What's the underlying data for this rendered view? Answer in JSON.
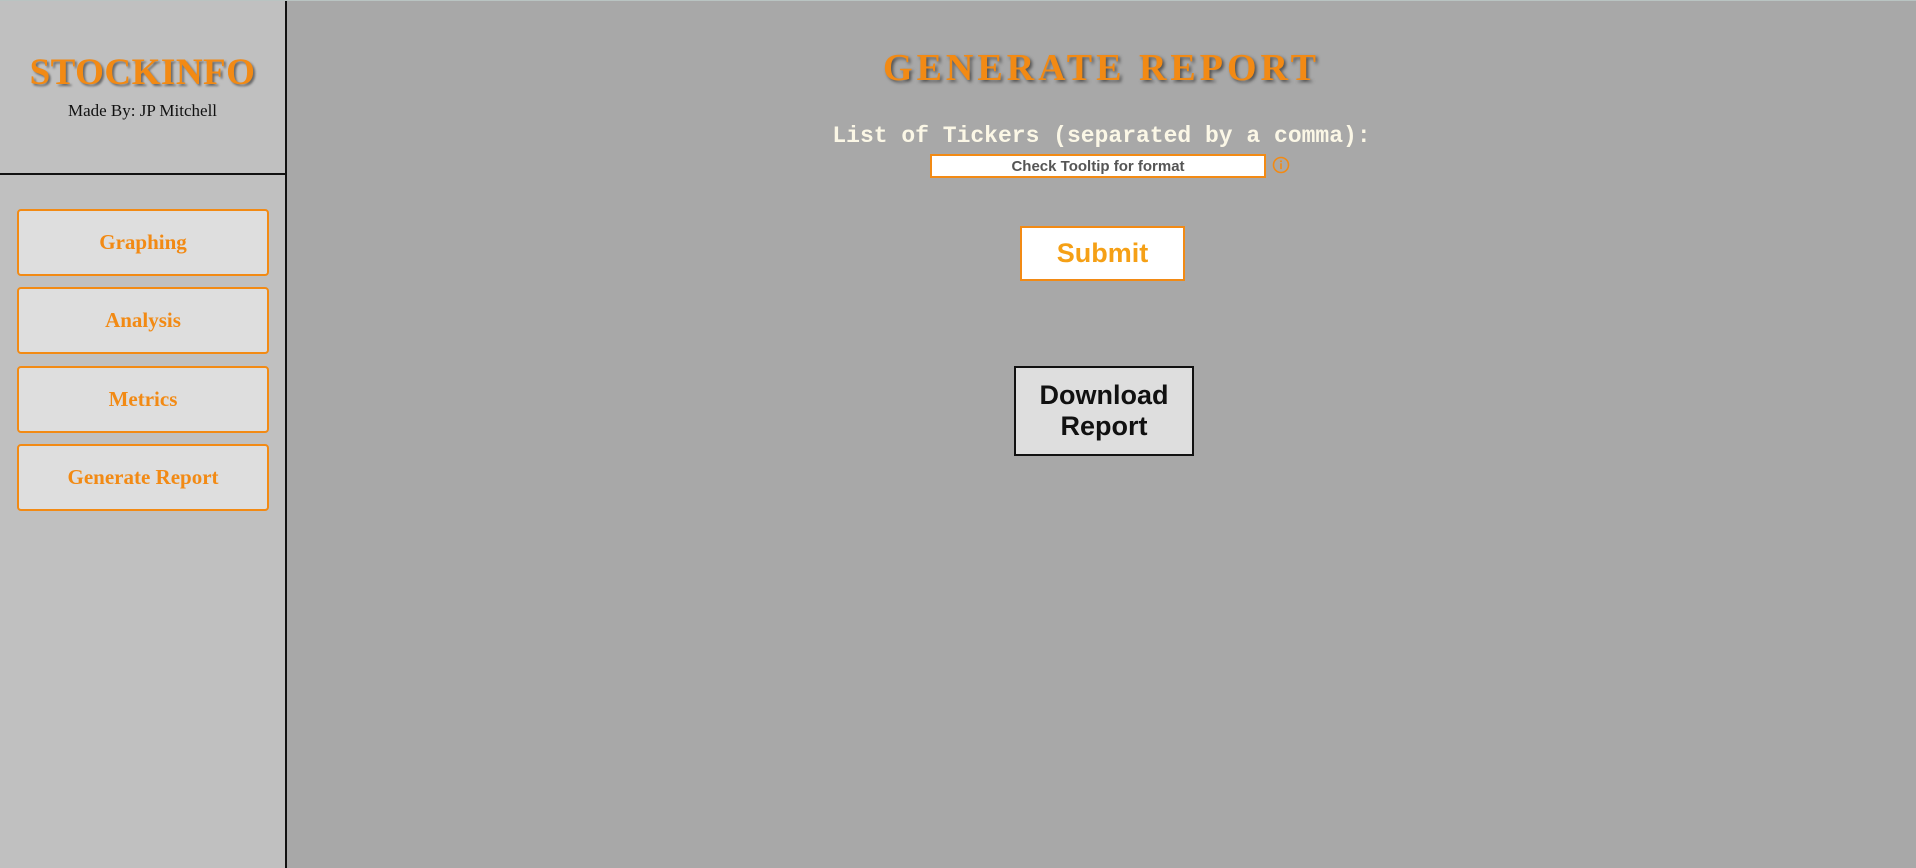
{
  "sidebar": {
    "brand_title": "STOCKINFO",
    "brand_subtitle": "Made By: JP Mitchell",
    "nav_items": [
      {
        "label": "Graphing"
      },
      {
        "label": "Analysis"
      },
      {
        "label": "Metrics"
      },
      {
        "label": "Generate Report"
      }
    ]
  },
  "main": {
    "title": "GENERATE REPORT",
    "tickers_label": "List of Tickers (separated by a comma):",
    "tickers_input": {
      "value": "",
      "placeholder": "Check Tooltip for format"
    },
    "info_icon": "info-circle-icon",
    "submit_label": "Submit",
    "download_label": "Download Report"
  },
  "colors": {
    "accent": "#f28a14",
    "sidebar_bg": "#c0c0c0",
    "main_bg": "#a8a8a8",
    "button_bg": "#dedede"
  }
}
